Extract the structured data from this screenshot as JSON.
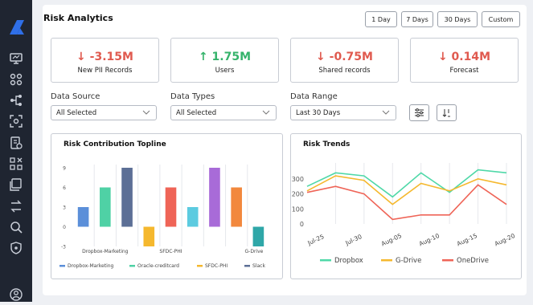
{
  "header": {
    "title": "Risk Analytics"
  },
  "date_ranges": [
    "1 Day",
    "7 Days",
    "30 Days",
    "Custom"
  ],
  "kpis": [
    {
      "value": "↓ -3.15M",
      "label": "New PII Records",
      "trend": "down"
    },
    {
      "value": "↑ 1.75M",
      "label": "Users",
      "trend": "up"
    },
    {
      "value": "↓ -0.75M",
      "label": "Shared records",
      "trend": "down"
    },
    {
      "value": "↓ 0.14M",
      "label": "Forecast",
      "trend": "down"
    }
  ],
  "filters": {
    "data_source": {
      "label": "Data Source",
      "value": "All Selected"
    },
    "data_types": {
      "label": "Data Types",
      "value": "All Selected"
    },
    "date_range": {
      "label": "Data Range",
      "value": "Last 30 Days"
    }
  },
  "colors": {
    "negative": "#e05a4f",
    "positive": "#35b36b",
    "sidebar": "#1f2531",
    "logo": "#2f6fe8"
  },
  "icons": [
    "logo-icon",
    "monitor-icon",
    "grid-icon",
    "share-icon",
    "scan-icon",
    "report-icon",
    "nodes-icon",
    "folder-icon",
    "transfer-icon",
    "search-icon",
    "shield-icon",
    "user-icon",
    "filter-sliders-icon",
    "sort-icon",
    "chevron-down-icon"
  ],
  "chart_data": [
    {
      "type": "bar",
      "title": "Risk Contribution Topline",
      "categories": [
        "Dropbox-Marketing",
        "Oracle-creditcard",
        "SFDC-PHI",
        "Slack"
      ],
      "x_tick_labels": [
        "Dropbox-Marketing",
        "SFDC-PHI",
        "G-Drive"
      ],
      "ylim": [
        -3,
        9
      ],
      "yticks": [
        -3,
        0,
        3,
        6,
        9
      ],
      "grid": "vertical",
      "bars": [
        {
          "series": "Dropbox-Marketing",
          "value": 3
        },
        {
          "series": "Oracle-creditcard",
          "value": 6
        },
        {
          "series": "Slack",
          "value": 9
        },
        {
          "series": "SFDC-PHI",
          "value": -3
        },
        {
          "series": "red",
          "value": 6
        },
        {
          "series": "light-blue",
          "value": 3
        },
        {
          "series": "purple",
          "value": 9
        },
        {
          "series": "orange",
          "value": 6
        },
        {
          "series": "teal",
          "value": -3
        }
      ],
      "bar_colors": {
        "Dropbox-Marketing": "#5b8fd9",
        "Oracle-creditcard": "#4fd1a5",
        "Slack": "#5c6f96",
        "SFDC-PHI": "#f5b82e",
        "red": "#ef6457",
        "light-blue": "#5ccbe0",
        "purple": "#a86bd8",
        "orange": "#f2883d",
        "teal": "#2fa7a8"
      },
      "legend": [
        {
          "name": "Dropbox-Marketing",
          "color": "#5b8fd9"
        },
        {
          "name": "Oracle-creditcard",
          "color": "#4fd1a5"
        },
        {
          "name": "SFDC-PHI",
          "color": "#f5b82e"
        },
        {
          "name": "Slack",
          "color": "#5c6f96"
        }
      ],
      "legend_position": "bottom"
    },
    {
      "type": "line",
      "title": "Risk Trends",
      "x": [
        "Jul-25",
        "Jul-30",
        "Aug-05",
        "Aug-10",
        "Aug-15",
        "Aug-20"
      ],
      "ylim": [
        0,
        300
      ],
      "yticks": [
        0,
        100,
        200,
        300
      ],
      "grid": "vertical",
      "series": [
        {
          "name": "Dropbox",
          "color": "#4fd8a8",
          "values": [
            250,
            340,
            320,
            180,
            340,
            210,
            360,
            340
          ]
        },
        {
          "name": "G-Drive",
          "color": "#f5b82e",
          "values": [
            220,
            320,
            290,
            130,
            270,
            220,
            300,
            260
          ]
        },
        {
          "name": "OneDrive",
          "color": "#ef6457",
          "values": [
            210,
            250,
            200,
            30,
            60,
            60,
            260,
            130
          ]
        }
      ],
      "legend_position": "bottom"
    }
  ]
}
